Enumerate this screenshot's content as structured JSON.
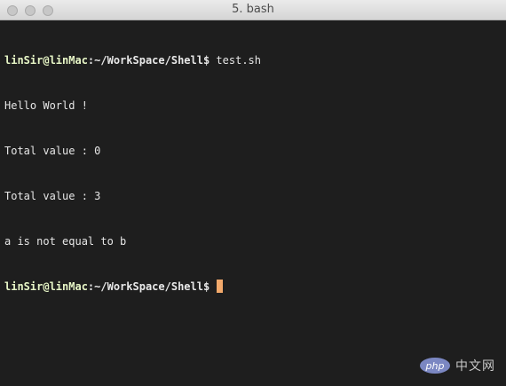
{
  "window": {
    "title": "5. bash"
  },
  "terminal": {
    "lines": [
      {
        "prompt_user": "linSir@linMac",
        "prompt_path": ":~/WorkSpace/Shell$",
        "command": " test.sh"
      },
      {
        "text": "Hello World !"
      },
      {
        "text": "Total value : 0"
      },
      {
        "text": "Total value : 3"
      },
      {
        "text": "a is not equal to b"
      },
      {
        "prompt_user": "linSir@linMac",
        "prompt_path": ":~/WorkSpace/Shell$",
        "command": " "
      }
    ]
  },
  "watermark": {
    "logo": "php",
    "text": "中文网"
  },
  "colors": {
    "background": "#1e1e1e",
    "prompt_user": "#e7f6c6",
    "cursor": "#f2a96b"
  }
}
